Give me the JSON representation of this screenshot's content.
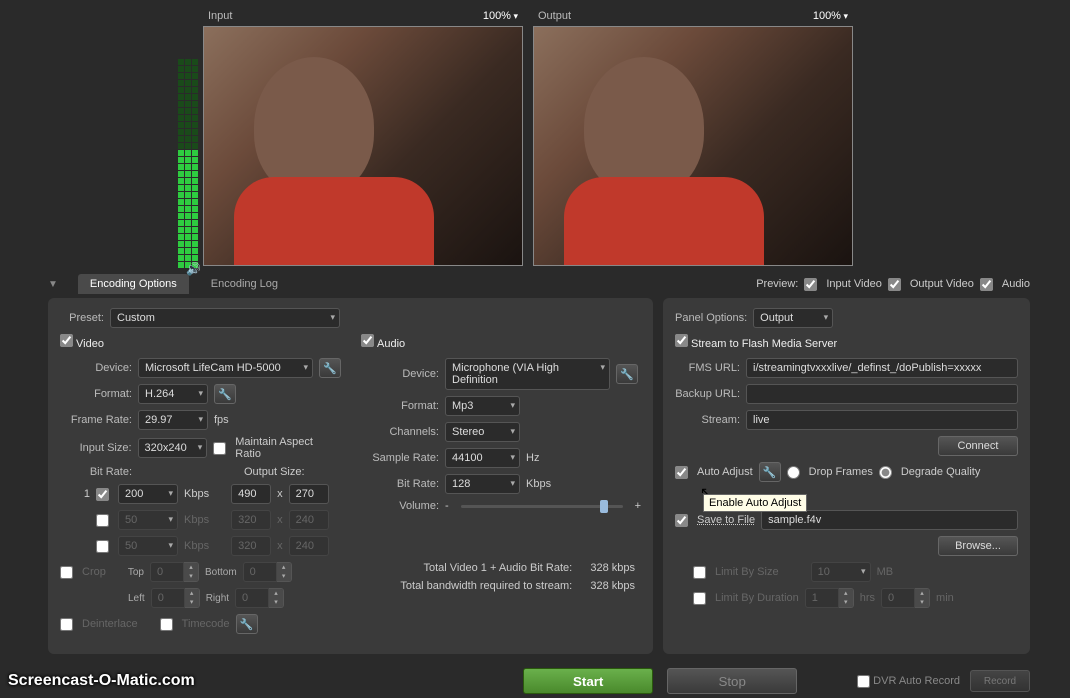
{
  "preview": {
    "input_label": "Input",
    "input_zoom": "100%",
    "output_label": "Output",
    "output_zoom": "100%",
    "toggles_label": "Preview:",
    "input_video": "Input Video",
    "output_video": "Output Video",
    "audio": "Audio"
  },
  "tabs": {
    "options": "Encoding Options",
    "log": "Encoding Log"
  },
  "preset": {
    "label": "Preset:",
    "value": "Custom"
  },
  "panel_options": {
    "label": "Panel Options:",
    "value": "Output"
  },
  "video": {
    "section": "Video",
    "device_label": "Device:",
    "device": "Microsoft LifeCam HD-5000",
    "format_label": "Format:",
    "format": "H.264",
    "framerate_label": "Frame Rate:",
    "framerate": "29.97",
    "fps": "fps",
    "inputsize_label": "Input Size:",
    "inputsize": "320x240",
    "maintain_aspect": "Maintain Aspect Ratio",
    "bitrate_label": "Bit Rate:",
    "outputsize_label": "Output Size:",
    "br1_idx": "1",
    "br1_val": "200",
    "kbps": "Kbps",
    "x": "x",
    "os_w": "490",
    "os_h": "270",
    "br2_val": "50",
    "os2_w": "320",
    "os2_h": "240",
    "br3_val": "50",
    "os3_w": "320",
    "os3_h": "240",
    "crop": "Crop",
    "top": "Top",
    "bottom": "Bottom",
    "left": "Left",
    "right": "Right",
    "zero": "0",
    "deinterlace": "Deinterlace",
    "timecode": "Timecode"
  },
  "audio": {
    "section": "Audio",
    "device_label": "Device:",
    "device": "Microphone (VIA High Definition",
    "format_label": "Format:",
    "format": "Mp3",
    "channels_label": "Channels:",
    "channels": "Stereo",
    "samplerate_label": "Sample Rate:",
    "samplerate": "44100",
    "hz": "Hz",
    "bitrate_label": "Bit Rate:",
    "bitrate": "128",
    "kbps": "Kbps",
    "volume_label": "Volume:",
    "minus": "-",
    "plus": "+",
    "total_video_label": "Total Video 1 + Audio Bit Rate:",
    "total_video_val": "328 kbps",
    "total_bw_label": "Total bandwidth required to stream:",
    "total_bw_val": "328 kbps"
  },
  "stream": {
    "section": "Stream to Flash Media Server",
    "fms_url_label": "FMS URL:",
    "fms_url": "i/streamingtvxxxlive/_definst_/doPublish=xxxxx",
    "backup_url_label": "Backup URL:",
    "backup_url": "",
    "stream_label": "Stream:",
    "stream": "live",
    "connect": "Connect",
    "auto_adjust": "Auto Adjust",
    "drop_frames": "Drop Frames",
    "degrade_quality": "Degrade Quality",
    "tooltip": "Enable Auto Adjust",
    "save_to_file": "Save to File",
    "filename": "sample.f4v",
    "browse": "Browse...",
    "limit_size": "Limit By Size",
    "size_val": "10",
    "mb": "MB",
    "limit_duration": "Limit By Duration",
    "dur_h": "1",
    "hrs": "hrs",
    "dur_m": "0",
    "min": "min"
  },
  "bottom": {
    "watermark": "Screencast-O-Matic.com",
    "start": "Start",
    "stop": "Stop",
    "dvr": "DVR Auto Record",
    "record": "Record"
  }
}
